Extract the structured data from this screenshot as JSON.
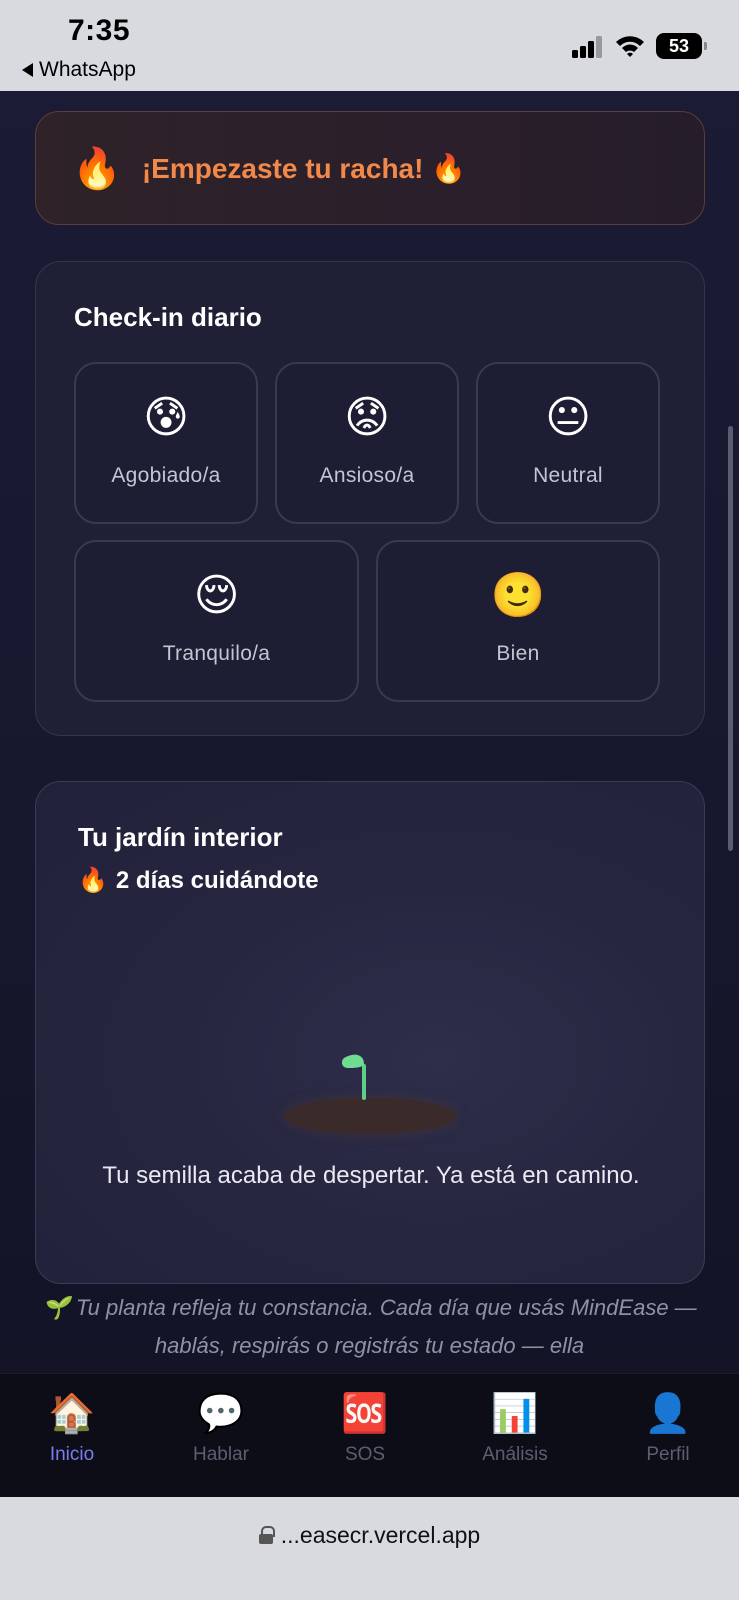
{
  "status_bar": {
    "time": "7:35",
    "back_label": "WhatsApp",
    "battery": "53"
  },
  "streak_banner": {
    "icon": "fire-icon",
    "text": "¡Empezaste tu racha! 🔥",
    "color": "#f2894a"
  },
  "checkin": {
    "title": "Check-in diario",
    "moods": [
      {
        "emoji": "😰",
        "label": "Agobiado/a"
      },
      {
        "emoji": "😟",
        "label": "Ansioso/a"
      },
      {
        "emoji": "😐",
        "label": "Neutral"
      },
      {
        "emoji": "😌",
        "label": "Tranquilo/a"
      },
      {
        "emoji": "🙂",
        "label": "Bien"
      }
    ]
  },
  "garden": {
    "title": "Tu jardín interior",
    "streak_text": "2 días cuidándote",
    "message": "Tu semilla acaba de despertar. Ya está en camino.",
    "note": "🌱 Tu planta refleja tu constancia. Cada día que usás MindEase — hablás, respirás o registrás tu estado — ella"
  },
  "tabs": [
    {
      "emoji": "🏠",
      "label": "Inicio",
      "active": true
    },
    {
      "emoji": "💬",
      "label": "Hablar",
      "active": false
    },
    {
      "emoji": "🆘",
      "label": "SOS",
      "active": false
    },
    {
      "emoji": "📊",
      "label": "Análisis",
      "active": false
    },
    {
      "emoji": "👤",
      "label": "Perfil",
      "active": false
    }
  ],
  "url_bar": {
    "url": "...easecr.vercel.app"
  },
  "colors": {
    "accent": "#7d7cf0",
    "streak_orange": "#f2894a",
    "background": "#161729"
  }
}
